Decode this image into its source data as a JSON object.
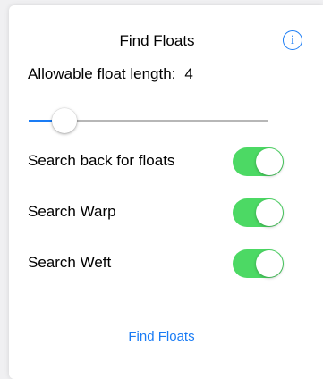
{
  "popover": {
    "title": "Find Floats",
    "info_icon": "info-circle-icon",
    "info_glyph": "i"
  },
  "length": {
    "label": "Allowable float length:",
    "value": "4"
  },
  "slider": {
    "fraction": 0.15
  },
  "toggles": [
    {
      "label": "Search back for floats",
      "on": true
    },
    {
      "label": "Search Warp",
      "on": true
    },
    {
      "label": "Search Weft",
      "on": true
    }
  ],
  "action": {
    "find_label": "Find Floats"
  },
  "colors": {
    "accent": "#1a7cf5",
    "switch_on": "#4cd964"
  }
}
